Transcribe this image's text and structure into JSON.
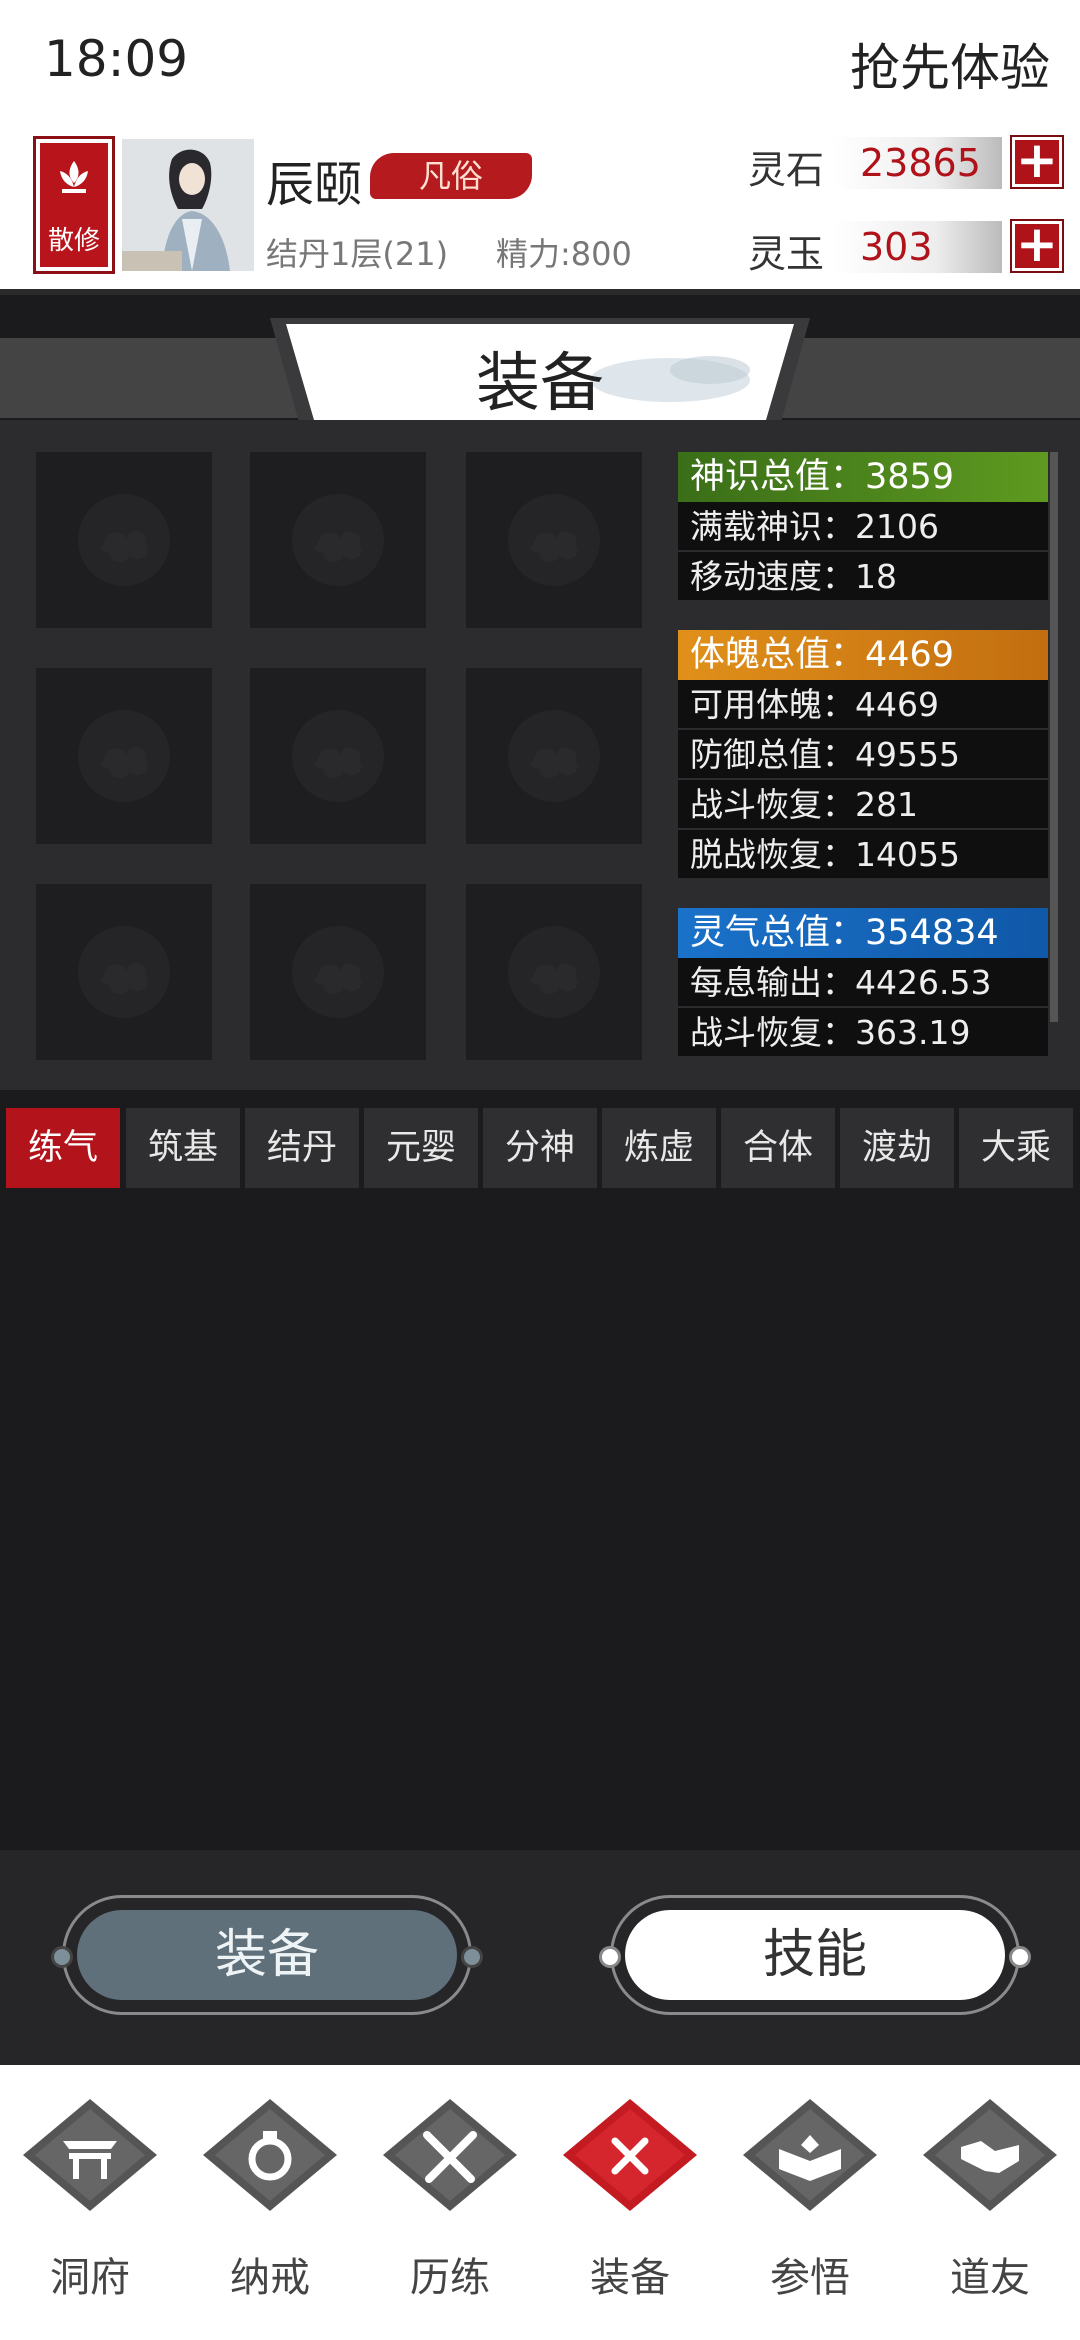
{
  "status_bar": {
    "time": "18:09",
    "right_text": "抢先体验"
  },
  "player": {
    "sect": "散修",
    "name": "辰颐",
    "rank": "凡俗",
    "realm": "结丹1层(21)",
    "energy": "精力:800"
  },
  "currency": [
    {
      "label": "灵石",
      "value": "23865",
      "plus": "+"
    },
    {
      "label": "灵玉",
      "value": "303",
      "plus": "+"
    }
  ],
  "page_title": "装备",
  "stats": {
    "mind": {
      "head": "神识总值：3859",
      "rows": [
        "满载神识：2106",
        "移动速度：18"
      ],
      "color": "#4a8a1c"
    },
    "body": {
      "head": "体魄总值：4469",
      "rows": [
        "可用体魄：4469",
        "防御总值：49555",
        "战斗恢复：281",
        "脱战恢复：14055"
      ],
      "color": "#e0901a"
    },
    "qi": {
      "head": "灵气总值：354834",
      "rows": [
        "每息输出：4426.53",
        "战斗恢复：363.19"
      ],
      "color": "#1a6ec4"
    }
  },
  "tabs": [
    "练气",
    "筑基",
    "结丹",
    "元婴",
    "分神",
    "炼虚",
    "合体",
    "渡劫",
    "大乘"
  ],
  "active_tab": "练气",
  "toggles": {
    "equip": "装备",
    "skill": "技能"
  },
  "nav": [
    {
      "label": "洞府",
      "icon": "gate-icon"
    },
    {
      "label": "纳戒",
      "icon": "ring-icon"
    },
    {
      "label": "历练",
      "icon": "crossed-swords-icon"
    },
    {
      "label": "装备",
      "icon": "close-x-icon"
    },
    {
      "label": "参悟",
      "icon": "book-icon"
    },
    {
      "label": "道友",
      "icon": "handshake-icon"
    }
  ],
  "accent_color": "#b3141c"
}
